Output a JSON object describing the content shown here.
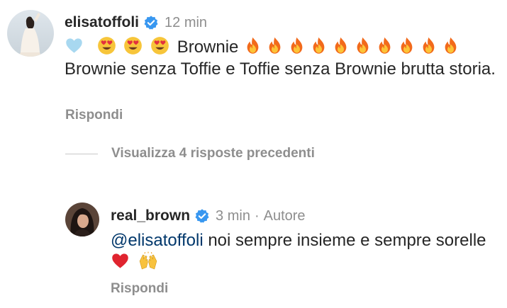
{
  "comment": {
    "username": "elisatoffoli",
    "timestamp": "12 min",
    "avatar_icon": "profile-photo-woman-raising-arm",
    "verified_icon": "verified-badge-icon",
    "emoji_lead": [
      "light-blue-heart",
      "heart-eyes",
      "heart-eyes",
      "heart-eyes"
    ],
    "text_part1": "Brownie",
    "fire_count": 10,
    "text_part2": "Brownie  senza Toffie e Toffie senza Brownie brutta storia.",
    "reply_label": "Rispondi"
  },
  "view_replies_label": "Visualizza 4 risposte precedenti",
  "reply": {
    "username": "real_brown",
    "timestamp": "3 min",
    "separator": "·",
    "author_label": "Autore",
    "avatar_icon": "profile-photo-dark-hair",
    "mention": "@elisatoffoli",
    "text_part1": " noi sempre insieme e sempre sorelle",
    "emoji_trail": [
      "red-heart",
      "raising-hands"
    ],
    "reply_label": "Rispondi"
  },
  "colors": {
    "text": "#262626",
    "secondary": "#8e8e8e",
    "mention": "#00376b",
    "verified": "#3897f0"
  }
}
